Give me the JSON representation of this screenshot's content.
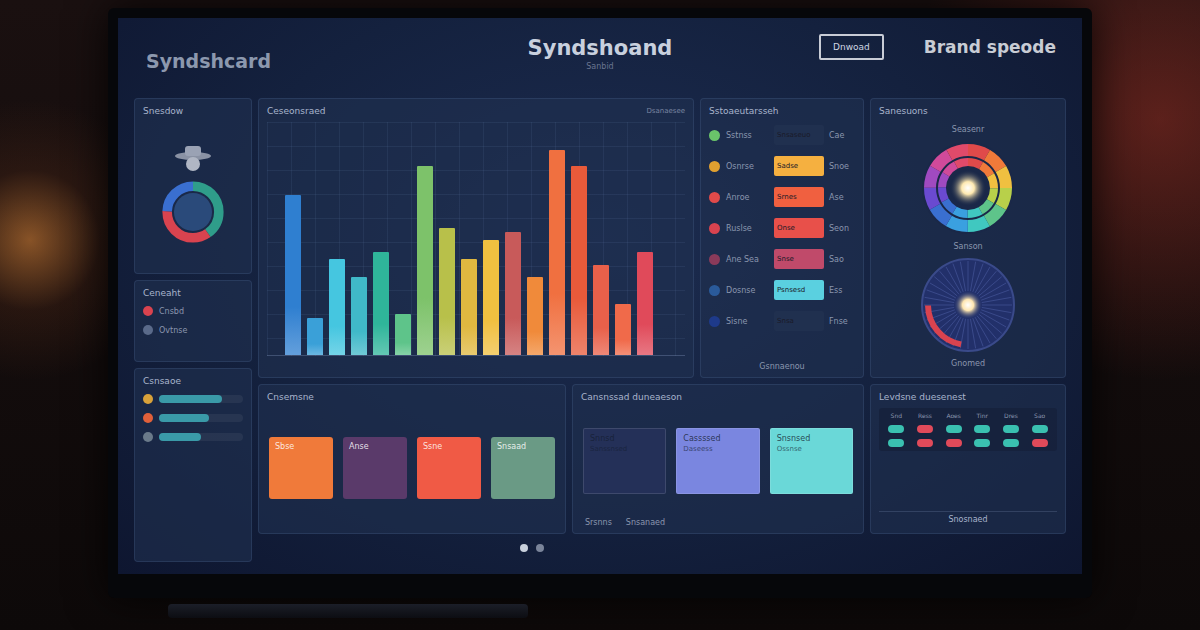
{
  "header": {
    "left": "Syndshcard",
    "title": "Syndshoand",
    "subtitle": "Sanbid",
    "button": "Dnwoad",
    "right": "Brand speode"
  },
  "sidebar": {
    "profile_title": "Snesdow",
    "donut": [
      {
        "value": 40,
        "color": "#2f9d8a"
      },
      {
        "value": 35,
        "color": "#d9434f"
      },
      {
        "value": 25,
        "color": "#3a6fd0"
      }
    ],
    "legend_title": "Ceneaht",
    "legend": [
      {
        "label": "Cnsbd",
        "color": "#d9434f"
      },
      {
        "label": "Ovtnse",
        "color": "#5a6a8a"
      }
    ],
    "status_title": "Csnsaoe",
    "status": [
      {
        "color": "#d9a23a",
        "level": 0.75
      },
      {
        "color": "#e0603a",
        "level": 0.6
      },
      {
        "color": "#6a7a8a",
        "level": 0.5
      }
    ]
  },
  "chart": {
    "title": "Ceseonsraed",
    "badge": "Dsanaesee",
    "max": 100,
    "bars": [
      {
        "value": 78,
        "color": "#2f7fd0"
      },
      {
        "value": 18,
        "color": "#3aa0d8"
      },
      {
        "value": 47,
        "color": "#45c6e0"
      },
      {
        "value": 38,
        "color": "#40b8c8"
      },
      {
        "value": 50,
        "color": "#2fb59a"
      },
      {
        "value": 20,
        "color": "#5ec48a"
      },
      {
        "value": 92,
        "color": "#7dc26a"
      },
      {
        "value": 62,
        "color": "#b8c04a"
      },
      {
        "value": 47,
        "color": "#e0b840"
      },
      {
        "value": 56,
        "color": "#f0c040"
      },
      {
        "value": 60,
        "color": "#c85a5a"
      },
      {
        "value": 38,
        "color": "#f08a3a"
      },
      {
        "value": 100,
        "color": "#f07040"
      },
      {
        "value": 92,
        "color": "#e85a3a"
      },
      {
        "value": 44,
        "color": "#e8604a"
      },
      {
        "value": 25,
        "color": "#f06a4a"
      },
      {
        "value": 50,
        "color": "#e04a5a"
      }
    ]
  },
  "list": {
    "title": "Sstoaeutarsseh",
    "footer": "Gsnnaenou",
    "rows": [
      {
        "label": "Sstnss",
        "dot": "#6ac46a",
        "box": "#20304f",
        "box_text": "Snsaseuo",
        "value": "Cae"
      },
      {
        "label": "Osnrse",
        "dot": "#e0a030",
        "box": "#f5b040",
        "box_text": "Sadse",
        "value": "Snoe"
      },
      {
        "label": "Anroe",
        "dot": "#e04a4a",
        "box": "#f06040",
        "box_text": "Srnes",
        "value": "Ase"
      },
      {
        "label": "Ruslse",
        "dot": "#d9434f",
        "box": "#e8504a",
        "box_text": "Onse",
        "value": "Seon"
      },
      {
        "label": "Ane Sea",
        "dot": "#8a3a5a",
        "box": "#c04a6a",
        "box_text": "Snse",
        "value": "Sao"
      },
      {
        "label": "Dosnse",
        "dot": "#2a5a9a",
        "box": "#5ad0e0",
        "box_text": "Psnsesd",
        "value": "Ess"
      },
      {
        "label": "Sisne",
        "dot": "#1e3a8a",
        "box": "#20304f",
        "box_text": "Snsa",
        "value": "Fnse"
      }
    ]
  },
  "gauges": {
    "title": "Sanesuons",
    "top_label": "Seasenr",
    "mid_label": "Sanson",
    "bottom_label": "Gnomed",
    "wheel": [
      "#e04a4a",
      "#f07a3a",
      "#f0c040",
      "#b8d04a",
      "#5ec48a",
      "#40c8c0",
      "#3aa0e0",
      "#3a6fd0",
      "#6a4ad0",
      "#a04ac0",
      "#d04a9a",
      "#e04a6a"
    ],
    "dial": {
      "level": 0.22,
      "color": "#d9434f"
    }
  },
  "cards": {
    "title": "Cnsemsne",
    "items": [
      {
        "label": "Sbse",
        "color": "#f07a3a"
      },
      {
        "label": "Anse",
        "color": "#5a3a6a"
      },
      {
        "label": "Ssne",
        "color": "#f05a45"
      },
      {
        "label": "Snsaad",
        "color": "#6a9a85"
      }
    ]
  },
  "tiles": {
    "title": "Cansnssad duneaeson",
    "items": [
      {
        "label": "Snnsd",
        "sub": "Sanssnsed",
        "color": "#243058"
      },
      {
        "label": "Cassssed",
        "sub": "Daseess",
        "color": "#7a86e0"
      },
      {
        "label": "Snsnsed",
        "sub": "Ossnse",
        "color": "#6ad8d8"
      }
    ],
    "footer": [
      "Srsnns",
      "Snsanaed"
    ]
  },
  "table": {
    "title": "Levdsne duesenest",
    "columns": [
      "Snd",
      "Ress",
      "Aoes",
      "Tinr",
      "Dres",
      "Sao"
    ],
    "rows": [
      {
        "cells": [
          "#3ac0b0",
          "#e04a5a",
          "#3ac0b0",
          "#3ac0b0",
          "#3ac0b0",
          "#3ac0b0"
        ]
      },
      {
        "cells": [
          "#3ac0b0",
          "#e04a5a",
          "#e04a5a",
          "#3ac0b0",
          "#3ac0b0",
          "#e04a5a"
        ]
      }
    ],
    "button": "Snosnaed"
  },
  "pager": [
    {
      "selected": true
    },
    {
      "selected": false
    }
  ]
}
